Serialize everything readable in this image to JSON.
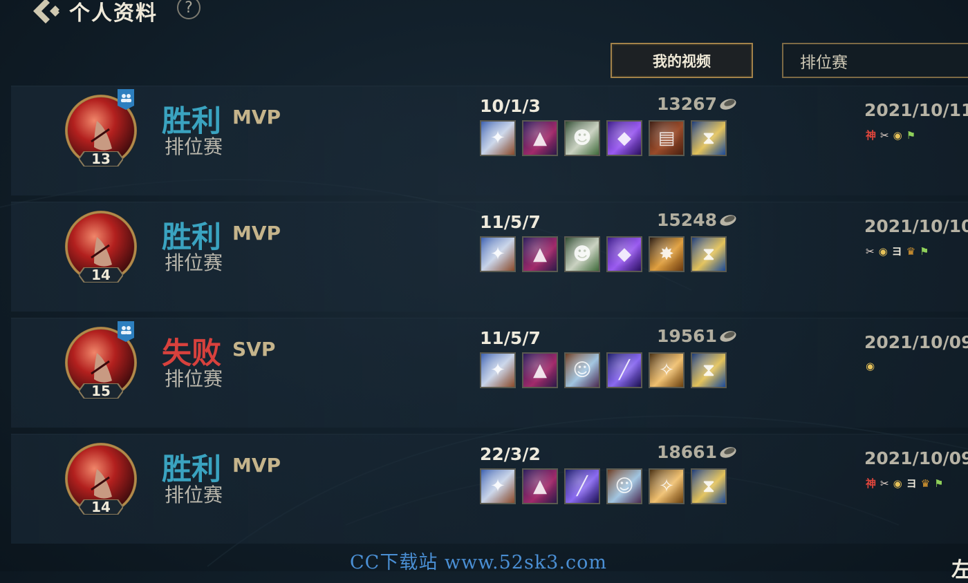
{
  "header": {
    "title": "个人资料",
    "help_label": "?"
  },
  "toolbar": {
    "videos_label": "我的视频",
    "queue_filter": "排位赛"
  },
  "colors": {
    "win": "#3aa3c0",
    "loss": "#d8413d",
    "accent_gold": "#a4834a"
  },
  "matches": [
    {
      "result": "胜利",
      "grade": "MVP",
      "queue": "排位赛",
      "level": "13",
      "group": true,
      "kda": "10/1/3",
      "gold": "13267",
      "date": "2021/10/11",
      "items": [
        "spellblade-icon",
        "hat-icon",
        "mask-icon",
        "crystal-icon",
        "tome-icon",
        "hourglass-icon"
      ],
      "tags": [
        "神",
        "✂",
        "◉",
        "⚑"
      ]
    },
    {
      "result": "胜利",
      "grade": "MVP",
      "queue": "排位赛",
      "level": "14",
      "group": false,
      "kda": "11/5/7",
      "gold": "15248",
      "date": "2021/10/10",
      "items": [
        "spellblade-icon",
        "hat-icon",
        "mask-icon",
        "crystal-icon",
        "mace-icon",
        "hourglass-icon"
      ],
      "tags": [
        "✂",
        "◉",
        "ヨ",
        "♛",
        "⚑"
      ]
    },
    {
      "result": "失败",
      "grade": "SVP",
      "queue": "排位赛",
      "level": "15",
      "group": true,
      "kda": "11/5/7",
      "gold": "19561",
      "date": "2021/10/09",
      "items": [
        "spellblade-icon",
        "hat-icon",
        "boots-icon",
        "staff-icon",
        "angel-icon",
        "hourglass-icon"
      ],
      "tags": [
        "◉"
      ]
    },
    {
      "result": "胜利",
      "grade": "MVP",
      "queue": "排位赛",
      "level": "14",
      "group": false,
      "kda": "22/3/2",
      "gold": "18661",
      "date": "2021/10/09",
      "items": [
        "spellblade-icon",
        "hat-icon",
        "staff-icon",
        "boots-icon",
        "angel-icon",
        "hourglass-icon"
      ],
      "tags": [
        "神",
        "✂",
        "◉",
        "ヨ",
        "♛",
        "⚑"
      ]
    }
  ],
  "watermark": "CC下载站 www.52sk3.com",
  "corner_char": "左"
}
